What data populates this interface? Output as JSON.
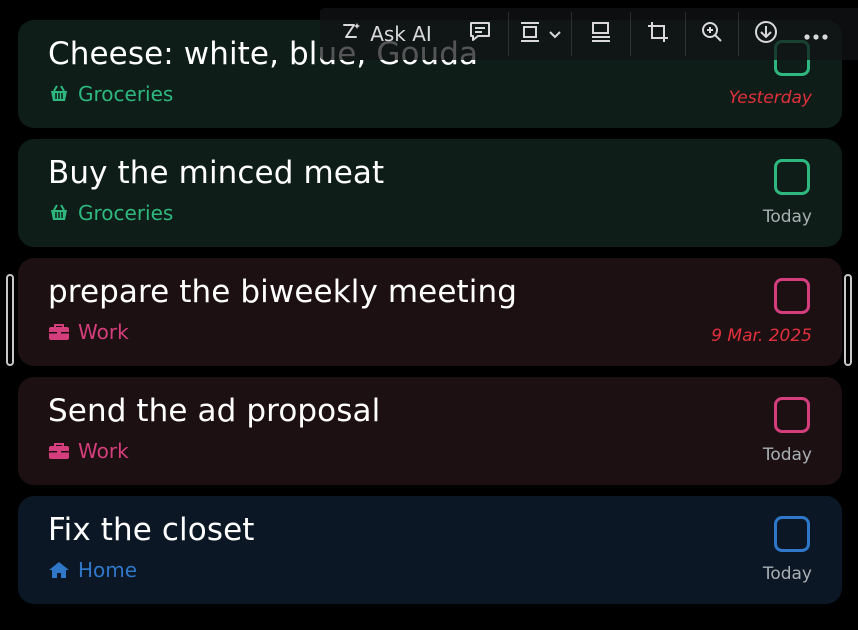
{
  "toolbar": {
    "ask_ai_label": "Ask AI",
    "buttons": [
      "ask-ai",
      "comment",
      "layout",
      "align",
      "crop",
      "zoom-in",
      "download",
      "more"
    ]
  },
  "tasks": [
    {
      "title": "Cheese: white, blue, Gouda",
      "category": "Groceries",
      "category_icon": "basket-icon",
      "date": "Yesterday",
      "overdue": true,
      "accent": "#2eb87f"
    },
    {
      "title": "Buy the minced meat",
      "category": "Groceries",
      "category_icon": "basket-icon",
      "date": "Today",
      "overdue": false,
      "accent": "#2eb87f"
    },
    {
      "title": "prepare the biweekly meeting",
      "category": "Work",
      "category_icon": "briefcase-icon",
      "date": "9 Mar. 2025",
      "overdue": true,
      "accent": "#d43e7c"
    },
    {
      "title": "Send the ad proposal",
      "category": "Work",
      "category_icon": "briefcase-icon",
      "date": "Today",
      "overdue": false,
      "accent": "#d43e7c"
    },
    {
      "title": "Fix the closet",
      "category": "Home",
      "category_icon": "home-icon",
      "date": "Today",
      "overdue": false,
      "accent": "#2e77c9"
    }
  ],
  "colors": {
    "overdue": "#e2303d",
    "date_normal": "#a9b0b3",
    "background": "#000000"
  }
}
